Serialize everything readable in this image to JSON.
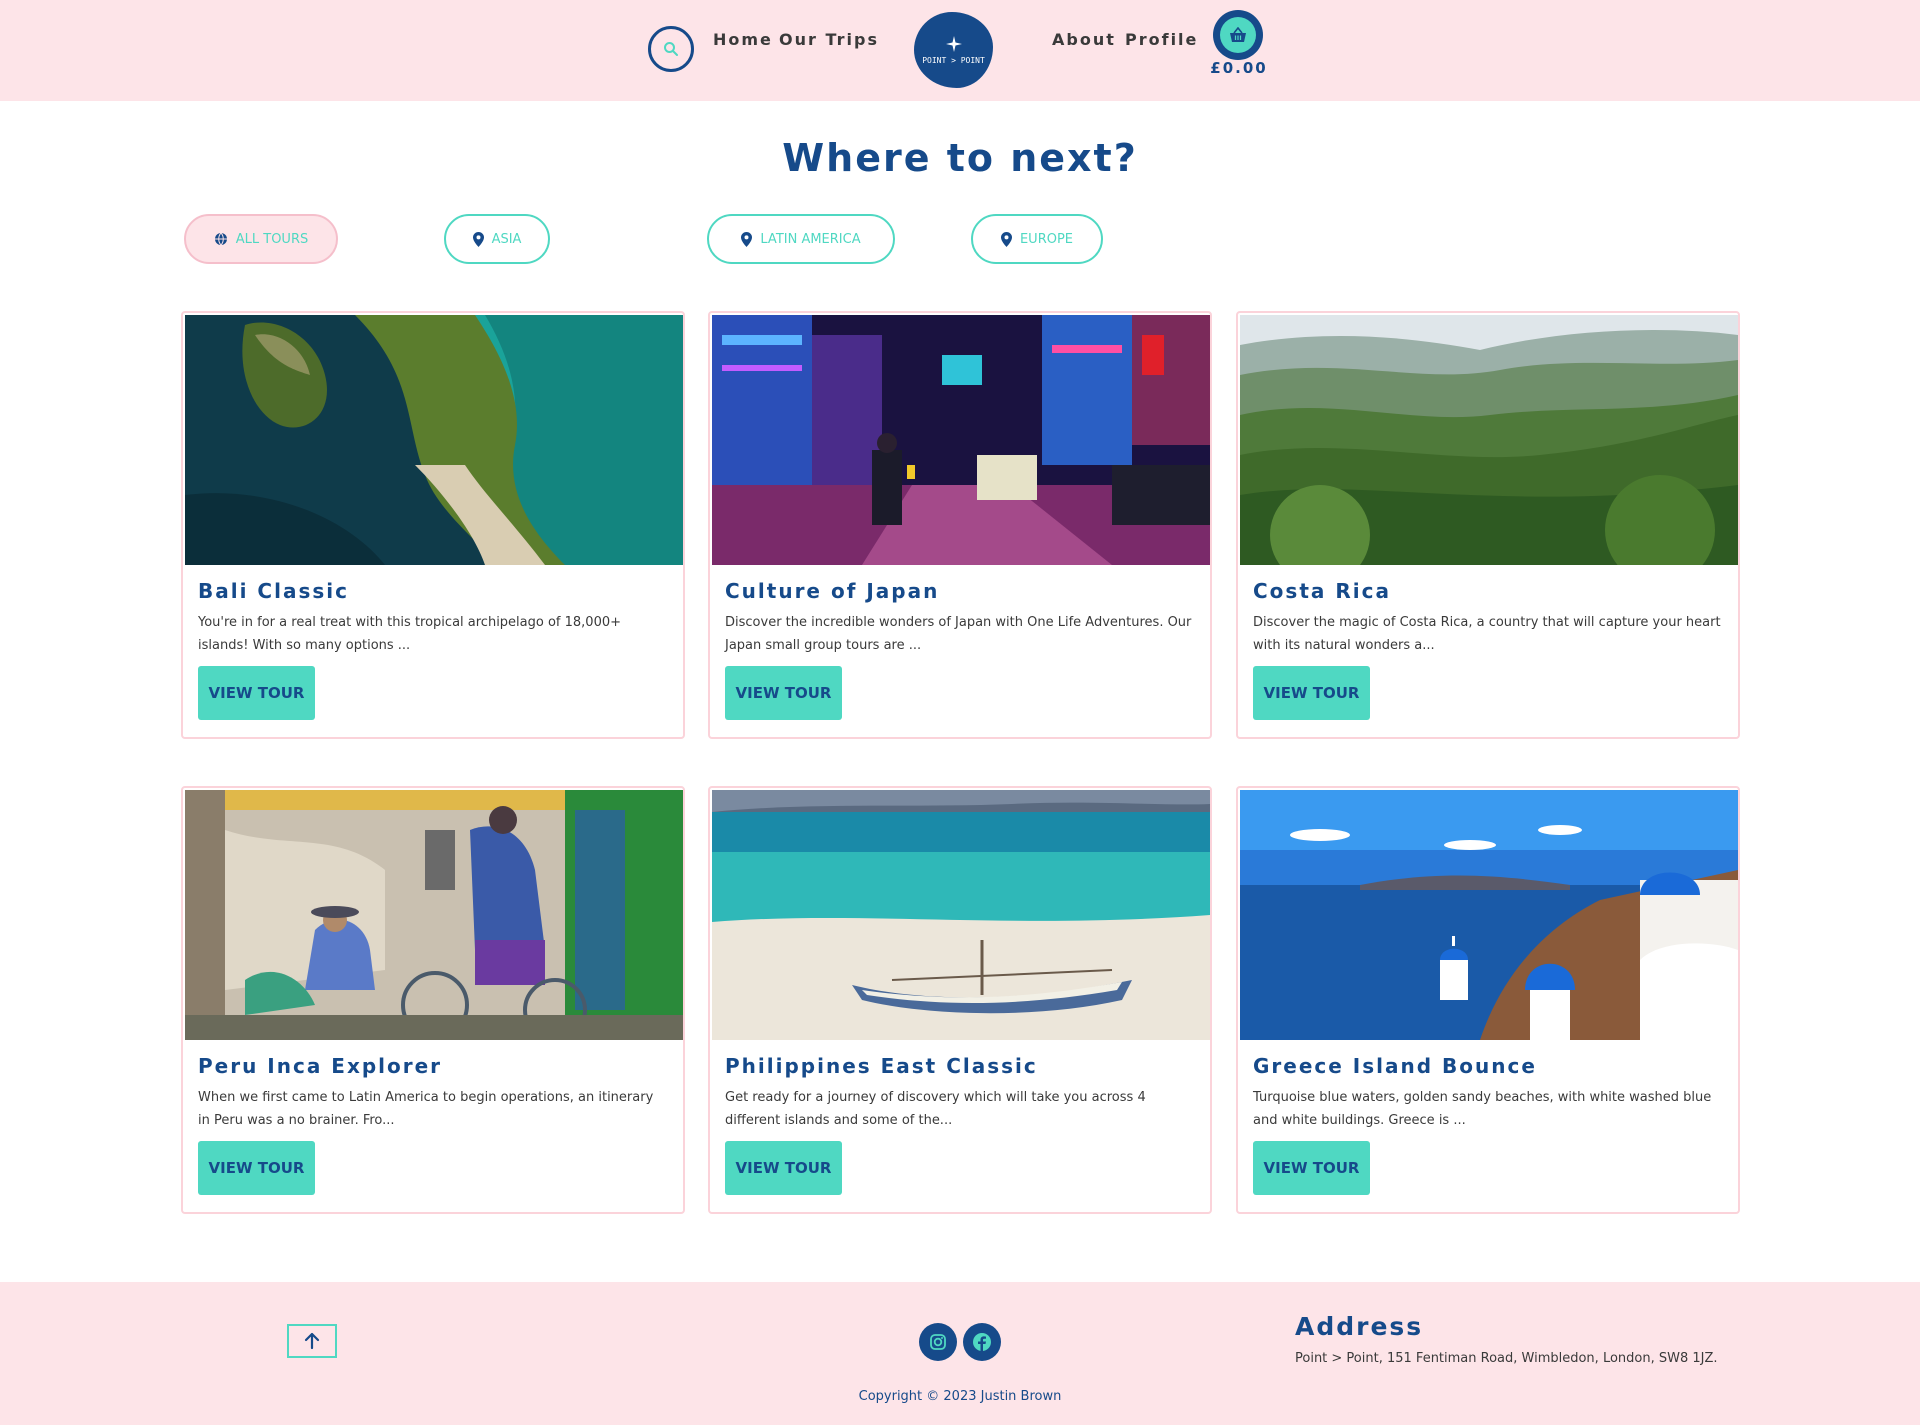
{
  "header": {
    "nav_left": [
      "Home",
      "Our Trips"
    ],
    "nav_right": [
      "About",
      "Profile"
    ],
    "logo_text": "POINT > POINT",
    "cart_total": "£0.00"
  },
  "main": {
    "title": "Where to next?",
    "filters": [
      {
        "label": "ALL TOURS",
        "icon": "globe-icon",
        "active": true
      },
      {
        "label": "ASIA",
        "icon": "map-pin-icon",
        "active": false
      },
      {
        "label": "LATIN AMERICA",
        "icon": "map-pin-icon",
        "active": false
      },
      {
        "label": "EUROPE",
        "icon": "map-pin-icon",
        "active": false
      }
    ],
    "tours": [
      {
        "title": "Bali Classic",
        "desc": "You're in for a real treat with this tropical archipelago of 18,000+ islands! With so many options ...",
        "button": "VIEW TOUR",
        "image": "aerial-coastline-cliffs"
      },
      {
        "title": "Culture of Japan",
        "desc": "Discover the incredible wonders of Japan with One Life Adventures. Our Japan small group tours are ...",
        "button": "VIEW TOUR",
        "image": "neon-city-street-night"
      },
      {
        "title": "Costa Rica",
        "desc": "Discover the magic of Costa Rica, a country that will capture your heart with its natural wonders a...",
        "button": "VIEW TOUR",
        "image": "green-jungle-valley"
      },
      {
        "title": "Peru Inca Explorer",
        "desc": "When we first came to Latin America to begin operations, an itinerary in Peru was a no brainer. Fro...",
        "button": "VIEW TOUR",
        "image": "street-market-women"
      },
      {
        "title": "Philippines East Classic",
        "desc": "Get ready for a journey of discovery which will take you across 4 different islands and some of the...",
        "button": "VIEW TOUR",
        "image": "beach-outrigger-boat"
      },
      {
        "title": "Greece Island Bounce",
        "desc": "Turquoise blue waters, golden sandy beaches, with white washed blue and white buildings. Greece is ...",
        "button": "VIEW TOUR",
        "image": "santorini-blue-domes"
      }
    ]
  },
  "footer": {
    "social": [
      "instagram-icon",
      "facebook-icon"
    ],
    "address_title": "Address",
    "address": "Point > Point, 151 Fentiman Road, Wimbledon, London, SW8 1JZ.",
    "copyright": "Copyright © 2023 Justin Brown"
  },
  "colors": {
    "pink": "#fde4e8",
    "navy": "#164a8a",
    "teal": "#4fd8c2"
  }
}
